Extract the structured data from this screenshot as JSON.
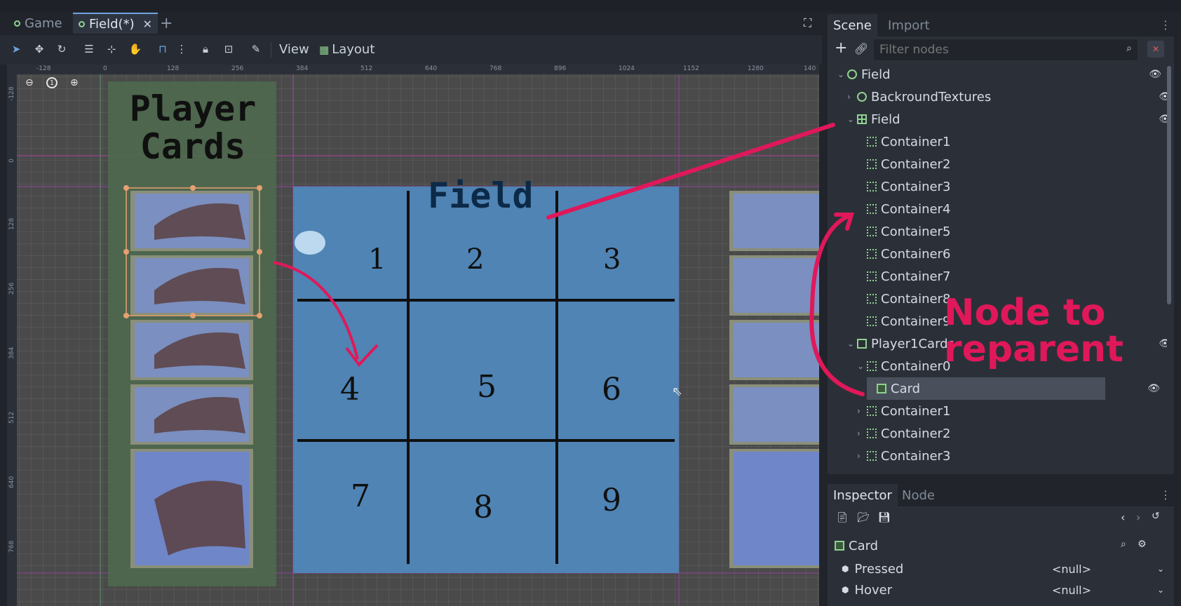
{
  "tabs": [
    {
      "label": "Game"
    },
    {
      "label": "Field(*)"
    }
  ],
  "toolbar": {
    "view_label": "View",
    "layout_label": "Layout"
  },
  "rulers": {
    "top": [
      "-128",
      "0",
      "128",
      "256",
      "384",
      "512",
      "640",
      "768",
      "896",
      "1024",
      "1152",
      "1280",
      "140"
    ],
    "left": [
      "-128",
      "0",
      "128",
      "256",
      "384",
      "512",
      "640",
      "768"
    ]
  },
  "viewport": {
    "zoom_reset": "1",
    "player_cards_title": "Player\nCards",
    "field_label": "Field",
    "grid_numbers": [
      "1",
      "2",
      "3",
      "4",
      "5",
      "6",
      "7",
      "8",
      "9"
    ],
    "annotation": "Node to\nreparent"
  },
  "scene": {
    "tab_scene": "Scene",
    "tab_import": "Import",
    "filter_placeholder": "Filter nodes",
    "tree": [
      {
        "label": "Field",
        "icon": "ring",
        "depth": 0,
        "expander": "v"
      },
      {
        "label": "BackroundTextures",
        "icon": "ring",
        "depth": 1,
        "expander": ">"
      },
      {
        "label": "Field",
        "icon": "grid",
        "depth": 1,
        "expander": "v"
      },
      {
        "label": "Container1",
        "icon": "container",
        "depth": 2,
        "expander": ""
      },
      {
        "label": "Container2",
        "icon": "container",
        "depth": 2,
        "expander": ""
      },
      {
        "label": "Container3",
        "icon": "container",
        "depth": 2,
        "expander": ""
      },
      {
        "label": "Container4",
        "icon": "container",
        "depth": 2,
        "expander": ""
      },
      {
        "label": "Container5",
        "icon": "container",
        "depth": 2,
        "expander": ""
      },
      {
        "label": "Container6",
        "icon": "container",
        "depth": 2,
        "expander": ""
      },
      {
        "label": "Container7",
        "icon": "container",
        "depth": 2,
        "expander": ""
      },
      {
        "label": "Container8",
        "icon": "container",
        "depth": 2,
        "expander": ""
      },
      {
        "label": "Container9",
        "icon": "container",
        "depth": 2,
        "expander": ""
      },
      {
        "label": "Player1Cards",
        "icon": "vbox",
        "depth": 1,
        "expander": "v"
      },
      {
        "label": "Container0",
        "icon": "container",
        "depth": 2,
        "expander": "v"
      },
      {
        "label": "Card",
        "icon": "card",
        "depth": 3,
        "expander": "",
        "selected": true
      },
      {
        "label": "Container1",
        "icon": "container",
        "depth": 2,
        "expander": ">"
      },
      {
        "label": "Container2",
        "icon": "container",
        "depth": 2,
        "expander": ">"
      },
      {
        "label": "Container3",
        "icon": "container",
        "depth": 2,
        "expander": ">"
      }
    ]
  },
  "inspector": {
    "tab_inspector": "Inspector",
    "tab_node": "Node",
    "object_name": "Card",
    "properties": [
      {
        "name": "Pressed",
        "value": "<null>"
      },
      {
        "name": "Hover",
        "value": "<null>"
      }
    ]
  },
  "colors": {
    "accent": "#6fa3e0",
    "annotation": "#e0185a",
    "field_fill": "#4f84b4",
    "player_panel": "#4e6b4e"
  }
}
